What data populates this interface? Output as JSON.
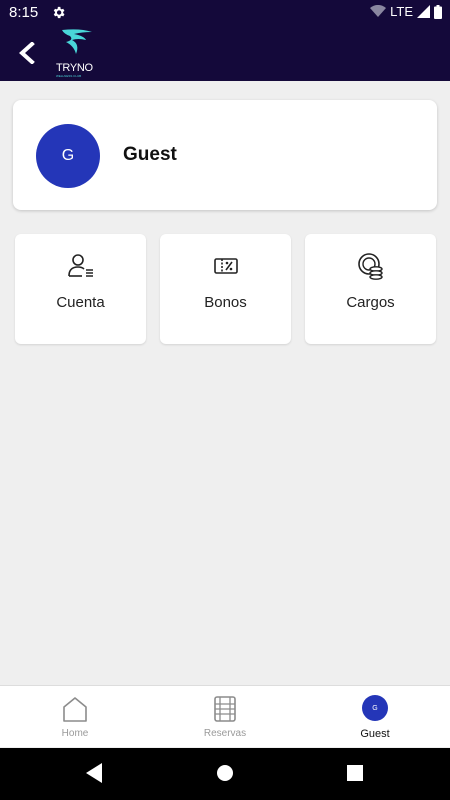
{
  "status_bar": {
    "time": "8:15",
    "network": "LTE"
  },
  "header": {
    "logo_text": "TRYNO",
    "logo_subtext": "WELLNESS CLUB"
  },
  "profile": {
    "avatar_initial": "G",
    "name": "Guest"
  },
  "tiles": [
    {
      "label": "Cuenta",
      "icon": "user-list-icon"
    },
    {
      "label": "Bonos",
      "icon": "voucher-percent-icon"
    },
    {
      "label": "Cargos",
      "icon": "coins-icon"
    }
  ],
  "bottom_nav": {
    "items": [
      {
        "label": "Home",
        "icon": "home-icon"
      },
      {
        "label": "Reservas",
        "icon": "calendar-film-icon"
      },
      {
        "label": "Guest",
        "avatar_initial": "G",
        "active": true
      }
    ]
  },
  "colors": {
    "header_bg": "#14093a",
    "accent": "#2436b8",
    "logo_teal": "#49d6d8"
  }
}
